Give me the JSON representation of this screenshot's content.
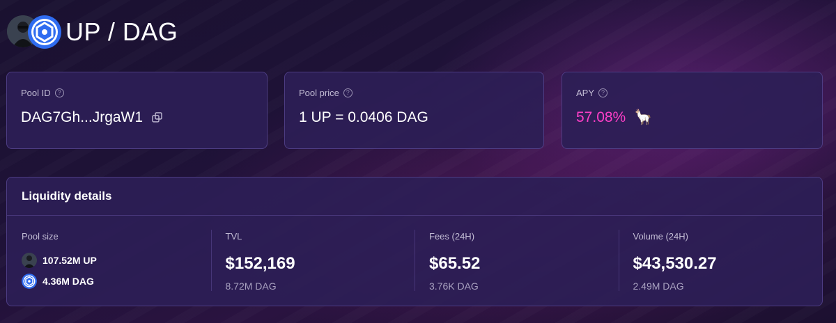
{
  "header": {
    "title": "UP / DAG"
  },
  "cards": {
    "pool_id": {
      "label": "Pool ID",
      "value": "DAG7Gh...JrgaW1"
    },
    "pool_price": {
      "label": "Pool price",
      "value": "1 UP = 0.0406 DAG"
    },
    "apy": {
      "label": "APY",
      "value": "57.08%",
      "emoji": "🦙"
    }
  },
  "liquidity": {
    "title": "Liquidity details",
    "pool_size": {
      "label": "Pool size",
      "items": [
        {
          "value": "107.52M UP",
          "icon": "up-token-icon"
        },
        {
          "value": "4.36M DAG",
          "icon": "dag-token-icon"
        }
      ]
    },
    "tvl": {
      "label": "TVL",
      "value": "$152,169",
      "sub": "8.72M DAG"
    },
    "fees": {
      "label": "Fees (24H)",
      "value": "$65.52",
      "sub": "3.76K DAG"
    },
    "volume": {
      "label": "Volume (24H)",
      "value": "$43,530.27",
      "sub": "2.49M DAG"
    }
  },
  "colors": {
    "accent_apy": "#ff3fc8",
    "dag_blue": "#2f6cf0"
  }
}
